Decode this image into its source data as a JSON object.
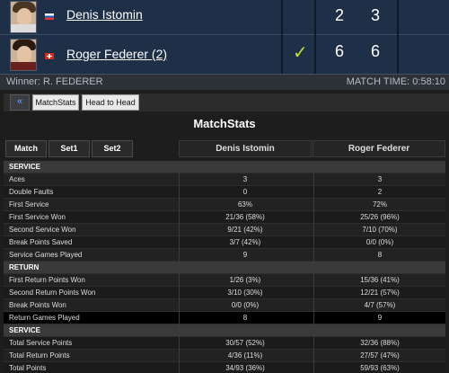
{
  "players": [
    {
      "name": "Denis Istomin",
      "flag": "uzbekistan-flag",
      "sets": [
        "2",
        "3"
      ],
      "winner": false
    },
    {
      "name": "Roger Federer (2)",
      "flag": "switzerland-flag",
      "sets": [
        "6",
        "6"
      ],
      "winner": true
    }
  ],
  "winner_text": "Winner: R. FEDERER",
  "match_time": "MATCH TIME: 0:58:10",
  "toolbar": {
    "back_icon": "double-chevron-left-icon",
    "matchstats_label": "MatchStats",
    "h2h_label": "Head to Head"
  },
  "title": "MatchStats",
  "tabs": [
    "Match",
    "Set1",
    "Set2"
  ],
  "columns": [
    "Denis Istomin",
    "Roger Federer"
  ],
  "rows": [
    {
      "type": "header",
      "label": "SERVICE"
    },
    {
      "label": "Aces",
      "p1": "3",
      "p2": "3"
    },
    {
      "label": "Double Faults",
      "p1": "0",
      "p2": "2"
    },
    {
      "label": "First Service",
      "p1": "63%",
      "p2": "72%"
    },
    {
      "label": "First Service Won",
      "p1": "21/36 (58%)",
      "p2": "25/26 (96%)"
    },
    {
      "label": "Second Service Won",
      "p1": "9/21 (42%)",
      "p2": "7/10 (70%)"
    },
    {
      "label": "Break Points Saved",
      "p1": "3/7 (42%)",
      "p2": "0/0 (0%)"
    },
    {
      "label": "Service Games Played",
      "p1": "9",
      "p2": "8"
    },
    {
      "type": "header",
      "label": "RETURN"
    },
    {
      "label": "First Return Points Won",
      "p1": "1/26 (3%)",
      "p2": "15/36 (41%)"
    },
    {
      "label": "Second Return Points Won",
      "p1": "3/10 (30%)",
      "p2": "12/21 (57%)"
    },
    {
      "label": "Break Points Won",
      "p1": "0/0 (0%)",
      "p2": "4/7 (57%)"
    },
    {
      "label": "Return Games Played",
      "p1": "8",
      "p2": "9",
      "highlight": true
    },
    {
      "type": "header",
      "label": "SERVICE"
    },
    {
      "label": "Total Service Points",
      "p1": "30/57 (52%)",
      "p2": "32/36 (88%)"
    },
    {
      "label": "Total Return Points",
      "p1": "4/36 (11%)",
      "p2": "27/57 (47%)"
    },
    {
      "label": "Total Points",
      "p1": "34/93 (36%)",
      "p2": "59/93 (63%)"
    }
  ],
  "colors": {
    "header_bg": "#1e3047",
    "check": "#c7dc3a",
    "back_arrow": "#6fa6ff"
  }
}
